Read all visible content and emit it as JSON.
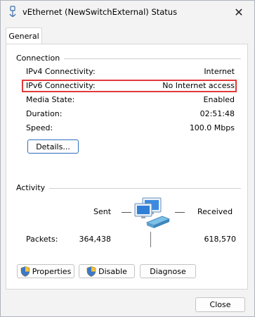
{
  "window": {
    "title": "vEthernet (NewSwitchExternal) Status",
    "close_glyph": "✕"
  },
  "tabs": [
    {
      "label": "General"
    }
  ],
  "connection": {
    "heading": "Connection",
    "rows": [
      {
        "label": "IPv4 Connectivity:",
        "value": "Internet"
      },
      {
        "label": "IPv6 Connectivity:",
        "value": "No Internet access"
      },
      {
        "label": "Media State:",
        "value": "Enabled"
      },
      {
        "label": "Duration:",
        "value": "02:51:48"
      },
      {
        "label": "Speed:",
        "value": "100.0 Mbps"
      }
    ],
    "details_button": "Details...",
    "highlight_color": "#e03a3a"
  },
  "activity": {
    "heading": "Activity",
    "sent_label": "Sent",
    "received_label": "Received",
    "packets_label": "Packets:",
    "packets_sent": "364,438",
    "packets_received": "618,570",
    "icon": "network-computers-icon"
  },
  "buttons": {
    "properties": "Properties",
    "disable": "Disable",
    "diagnose": "Diagnose",
    "close": "Close"
  },
  "colors": {
    "accent": "#2f6fc0",
    "highlight": "#e03a3a"
  }
}
